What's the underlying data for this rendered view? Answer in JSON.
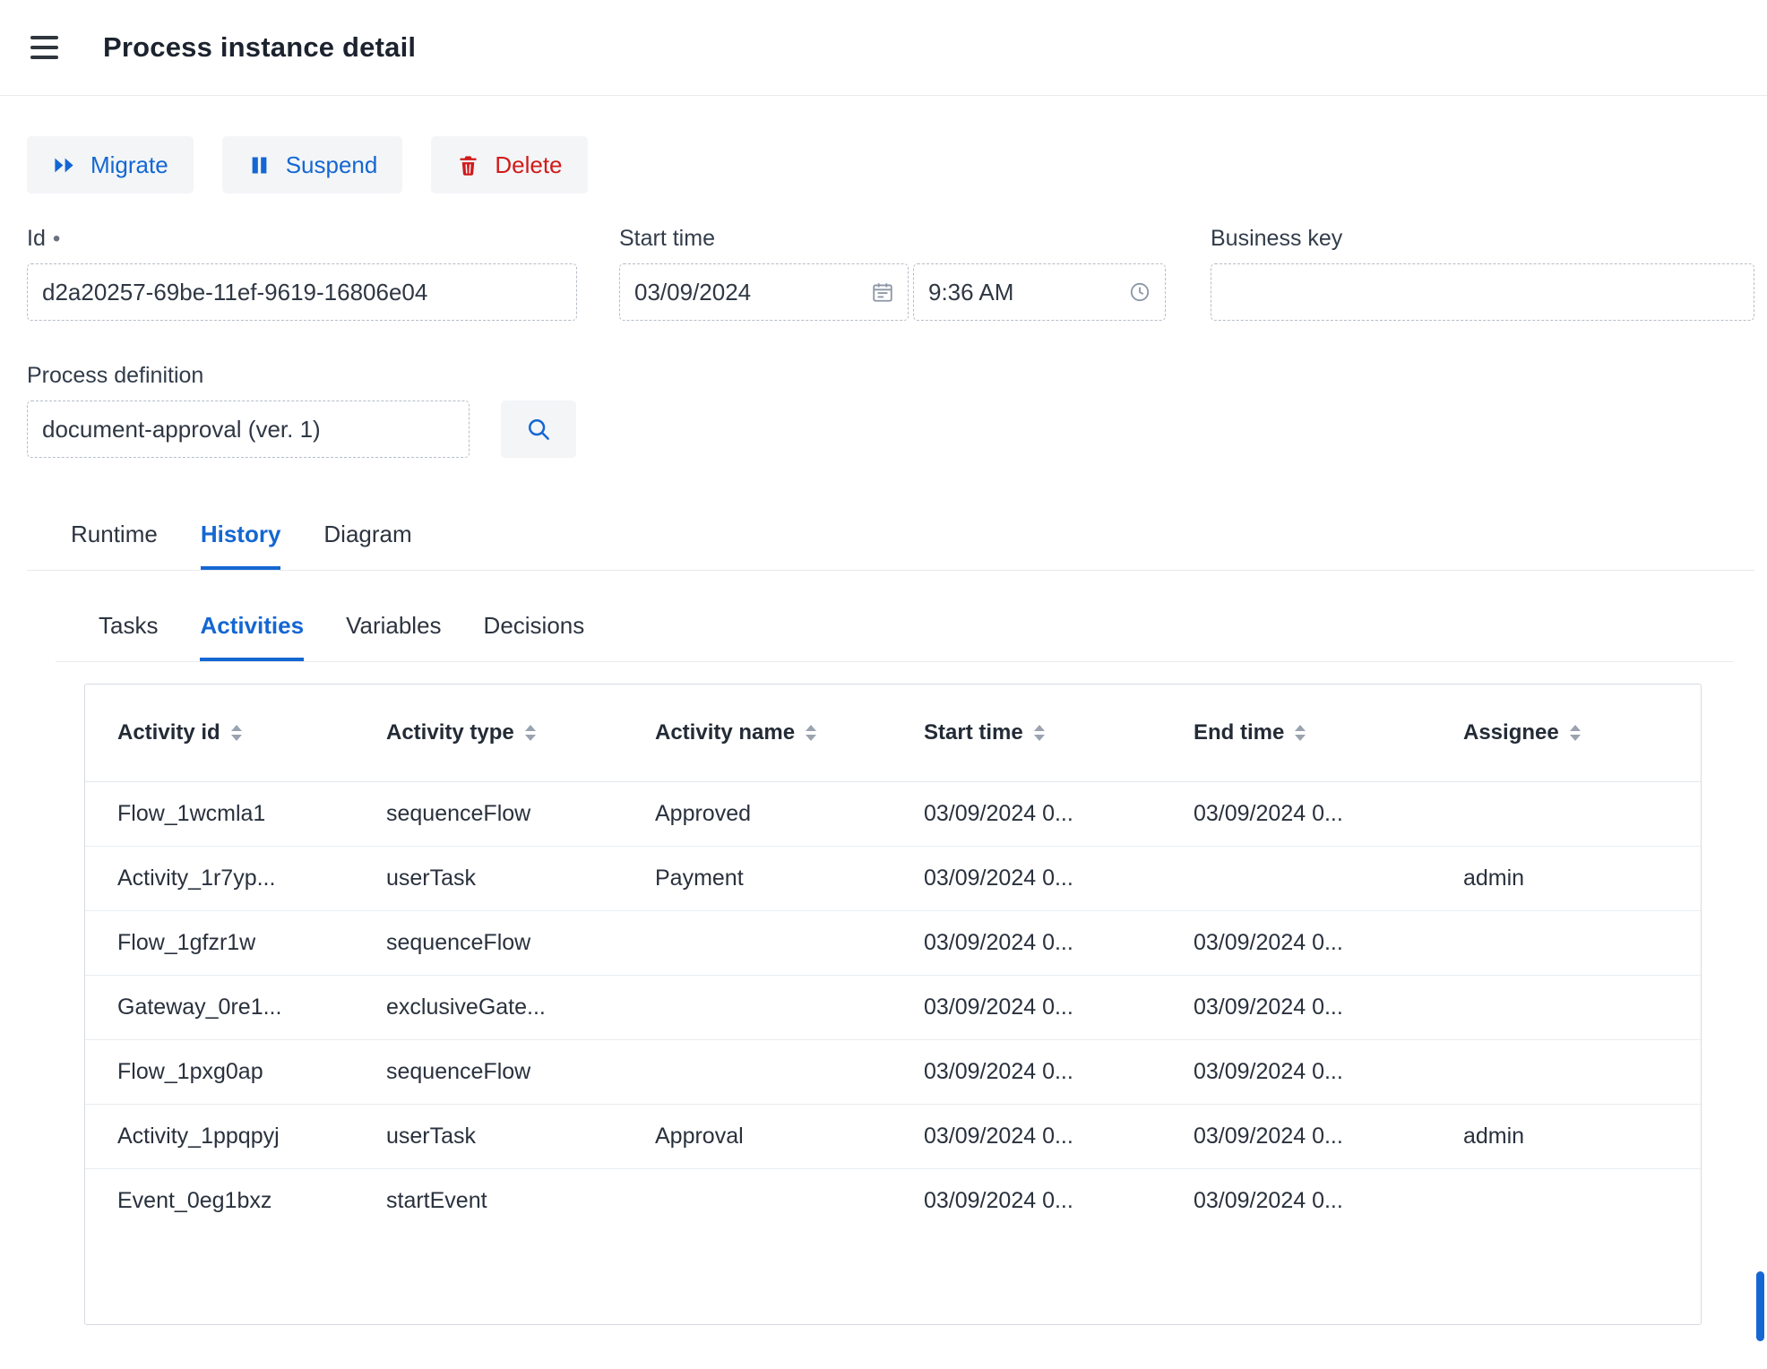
{
  "header": {
    "title": "Process instance detail"
  },
  "toolbar": {
    "migrate_label": "Migrate",
    "suspend_label": "Suspend",
    "delete_label": "Delete"
  },
  "form": {
    "id": {
      "label": "Id",
      "required_marker": "•",
      "value": "d2a20257-69be-11ef-9619-16806e04"
    },
    "start_time": {
      "label": "Start time",
      "date_value": "03/09/2024",
      "time_value": "9:36 AM"
    },
    "business_key": {
      "label": "Business key",
      "value": ""
    },
    "process_definition": {
      "label": "Process definition",
      "value": "document-approval (ver. 1)"
    }
  },
  "tabs": {
    "active": "History",
    "items": [
      {
        "label": "Runtime"
      },
      {
        "label": "History"
      },
      {
        "label": "Diagram"
      }
    ]
  },
  "subtabs": {
    "active": "Activities",
    "items": [
      {
        "label": "Tasks"
      },
      {
        "label": "Activities"
      },
      {
        "label": "Variables"
      },
      {
        "label": "Decisions"
      }
    ]
  },
  "activities_table": {
    "columns": [
      "Activity id",
      "Activity type",
      "Activity name",
      "Start time",
      "End time",
      "Assignee"
    ],
    "rows": [
      [
        "Flow_1wcmla1",
        "sequenceFlow",
        "Approved",
        "03/09/2024 0...",
        "03/09/2024 0...",
        ""
      ],
      [
        "Activity_1r7yp...",
        "userTask",
        "Payment",
        "03/09/2024 0...",
        "",
        "admin"
      ],
      [
        "Flow_1gfzr1w",
        "sequenceFlow",
        "",
        "03/09/2024 0...",
        "03/09/2024 0...",
        ""
      ],
      [
        "Gateway_0re1...",
        "exclusiveGate...",
        "",
        "03/09/2024 0...",
        "03/09/2024 0...",
        ""
      ],
      [
        "Flow_1pxg0ap",
        "sequenceFlow",
        "",
        "03/09/2024 0...",
        "03/09/2024 0...",
        ""
      ],
      [
        "Activity_1ppqpyj",
        "userTask",
        "Approval",
        "03/09/2024 0...",
        "03/09/2024 0...",
        "admin"
      ],
      [
        "Event_0eg1bxz",
        "startEvent",
        "",
        "03/09/2024 0...",
        "03/09/2024 0...",
        ""
      ]
    ]
  },
  "colors": {
    "accent": "#1467d2",
    "danger": "#d11a1a",
    "border_dashed": "#b6bdc7"
  }
}
